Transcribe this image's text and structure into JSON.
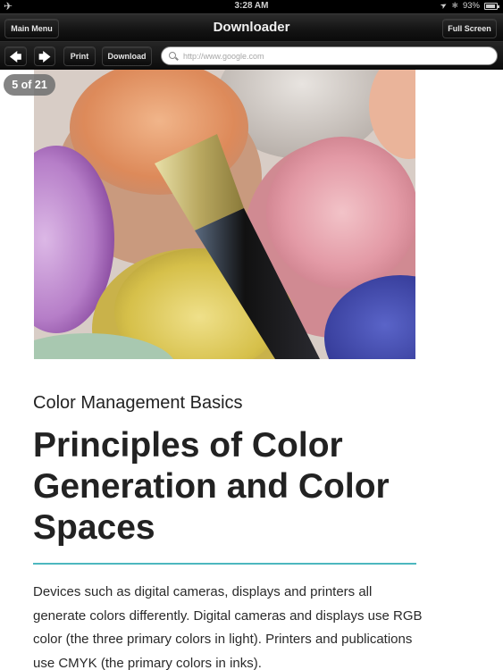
{
  "status_bar": {
    "time": "3:28 AM",
    "battery_percent_label": "93%",
    "battery_level": 0.93,
    "icons": [
      "airplane-icon",
      "location-arrow-icon",
      "bluetooth-icon",
      "battery-icon"
    ]
  },
  "nav": {
    "title": "Downloader",
    "main_menu_label": "Main Menu",
    "full_screen_label": "Full Screen"
  },
  "toolbar": {
    "back_icon": "left-arrow-icon",
    "forward_icon": "right-arrow-icon",
    "print_label": "Print",
    "download_label": "Download",
    "url_placeholder": "http://www.google.com",
    "url_value": ""
  },
  "page": {
    "badge": "5 of 21",
    "image_alt": "Open paint jars with a paintbrush",
    "kicker": "Color Management Basics",
    "headline": "Principles of Color Generation and Color Spaces",
    "accent_color": "#4db7bf",
    "body": "Devices such as digital cameras, displays and printers all generate colors differently. Digital cameras and displays use RGB color (the three primary colors in light). Printers and publications use CMYK (the primary colors in inks)."
  }
}
